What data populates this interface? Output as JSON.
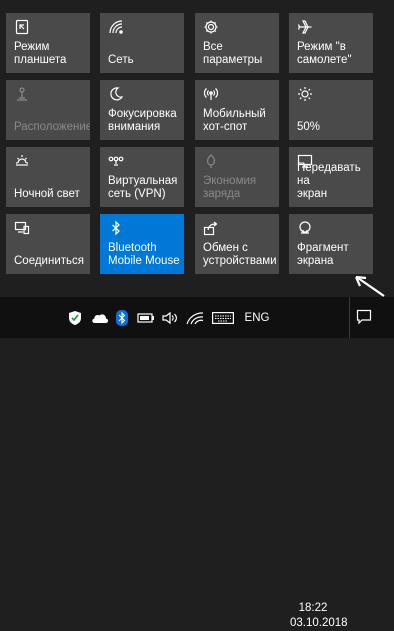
{
  "tiles": [
    {
      "label": "Режим\nпланшета",
      "icon": "tablet-mode-icon"
    },
    {
      "label": "Сеть",
      "icon": "network-icon"
    },
    {
      "label": "Все параметры",
      "icon": "gear-icon"
    },
    {
      "label": "Режим \"в\nсамолете\"",
      "icon": "airplane-icon"
    },
    {
      "label": "Расположение",
      "icon": "location-icon"
    },
    {
      "label": "Фокусировка\nвнимания",
      "icon": "moon-icon"
    },
    {
      "label": "Мобильный\nхот-спот",
      "icon": "hotspot-icon"
    },
    {
      "label": "50%",
      "icon": "brightness-icon"
    },
    {
      "label": "Ночной свет",
      "icon": "night-light-icon"
    },
    {
      "label": "Виртуальная\nсеть (VPN)",
      "icon": "vpn-icon"
    },
    {
      "label": "Экономия\nзаряда",
      "icon": "battery-saver-icon"
    },
    {
      "label": "Передавать на\nэкран",
      "icon": "project-icon"
    },
    {
      "label": "Соединиться",
      "icon": "connect-icon"
    },
    {
      "label": "Bluetooth\nMobile Mouse",
      "icon": "bluetooth-icon"
    },
    {
      "label": "Обмен с\nустройствами",
      "icon": "share-icon"
    },
    {
      "label": "Фрагмент\nэкрана",
      "icon": "snip-icon"
    }
  ],
  "taskbar": {
    "language": "ENG",
    "time": "18:22",
    "date": "03.10.2018"
  },
  "colors": {
    "tile": "#4a4a4a",
    "active_tile": "#0078d7",
    "panel": "#1f1f1f",
    "taskbar": "#101010",
    "disabled_text": "#8a8a8a"
  }
}
